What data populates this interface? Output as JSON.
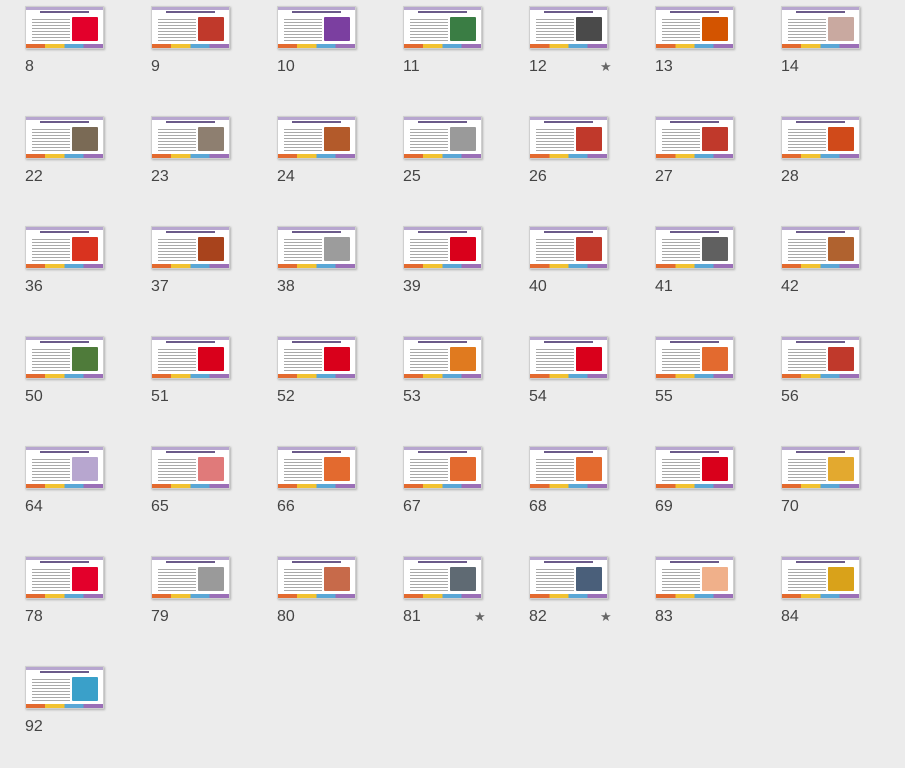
{
  "slides": [
    {
      "number": "8",
      "accent": "#e3002b",
      "starred": false
    },
    {
      "number": "9",
      "accent": "#c0392b",
      "starred": false
    },
    {
      "number": "10",
      "accent": "#7b3fa0",
      "starred": false
    },
    {
      "number": "11",
      "accent": "#3a7d44",
      "starred": false
    },
    {
      "number": "12",
      "accent": "#4a4a4a",
      "starred": true
    },
    {
      "number": "13",
      "accent": "#d35400",
      "starred": false
    },
    {
      "number": "14",
      "accent": "#c9a9a0",
      "starred": false
    },
    {
      "number": "22",
      "accent": "#7a6a55",
      "starred": false
    },
    {
      "number": "23",
      "accent": "#8e7f70",
      "starred": false
    },
    {
      "number": "24",
      "accent": "#b35a2a",
      "starred": false
    },
    {
      "number": "25",
      "accent": "#9a9a9a",
      "starred": false
    },
    {
      "number": "26",
      "accent": "#c0392b",
      "starred": false
    },
    {
      "number": "27",
      "accent": "#c0392b",
      "starred": false
    },
    {
      "number": "28",
      "accent": "#d04a1a",
      "starred": false
    },
    {
      "number": "36",
      "accent": "#d9331f",
      "starred": false
    },
    {
      "number": "37",
      "accent": "#a8431c",
      "starred": false
    },
    {
      "number": "38",
      "accent": "#9c9c9c",
      "starred": false
    },
    {
      "number": "39",
      "accent": "#d9001b",
      "starred": false
    },
    {
      "number": "40",
      "accent": "#c0392b",
      "starred": false
    },
    {
      "number": "41",
      "accent": "#606060",
      "starred": false
    },
    {
      "number": "42",
      "accent": "#b0622f",
      "starred": false
    },
    {
      "number": "50",
      "accent": "#4f7b3a",
      "starred": false
    },
    {
      "number": "51",
      "accent": "#d9001b",
      "starred": false
    },
    {
      "number": "52",
      "accent": "#d9001b",
      "starred": false
    },
    {
      "number": "53",
      "accent": "#e07a1f",
      "starred": false
    },
    {
      "number": "54",
      "accent": "#d9001b",
      "starred": false
    },
    {
      "number": "55",
      "accent": "#e36a2f",
      "starred": false
    },
    {
      "number": "56",
      "accent": "#c0392b",
      "starred": false
    },
    {
      "number": "64",
      "accent": "#b7a6cf",
      "starred": false
    },
    {
      "number": "65",
      "accent": "#e07a7a",
      "starred": false
    },
    {
      "number": "66",
      "accent": "#e36a2f",
      "starred": false
    },
    {
      "number": "67",
      "accent": "#e36a2f",
      "starred": false
    },
    {
      "number": "68",
      "accent": "#e36a2f",
      "starred": false
    },
    {
      "number": "69",
      "accent": "#d9001b",
      "starred": false
    },
    {
      "number": "70",
      "accent": "#e3a92f",
      "starred": false
    },
    {
      "number": "78",
      "accent": "#e3002b",
      "starred": false
    },
    {
      "number": "79",
      "accent": "#9a9a9a",
      "starred": false
    },
    {
      "number": "80",
      "accent": "#c76a4a",
      "starred": false
    },
    {
      "number": "81",
      "accent": "#5f6a73",
      "starred": true
    },
    {
      "number": "82",
      "accent": "#4a5f7a",
      "starred": true
    },
    {
      "number": "83",
      "accent": "#f0b08a",
      "starred": false
    },
    {
      "number": "84",
      "accent": "#d9a21a",
      "starred": false
    },
    {
      "number": "92",
      "accent": "#3aa0c9",
      "starred": false
    }
  ],
  "star_glyph": "★"
}
